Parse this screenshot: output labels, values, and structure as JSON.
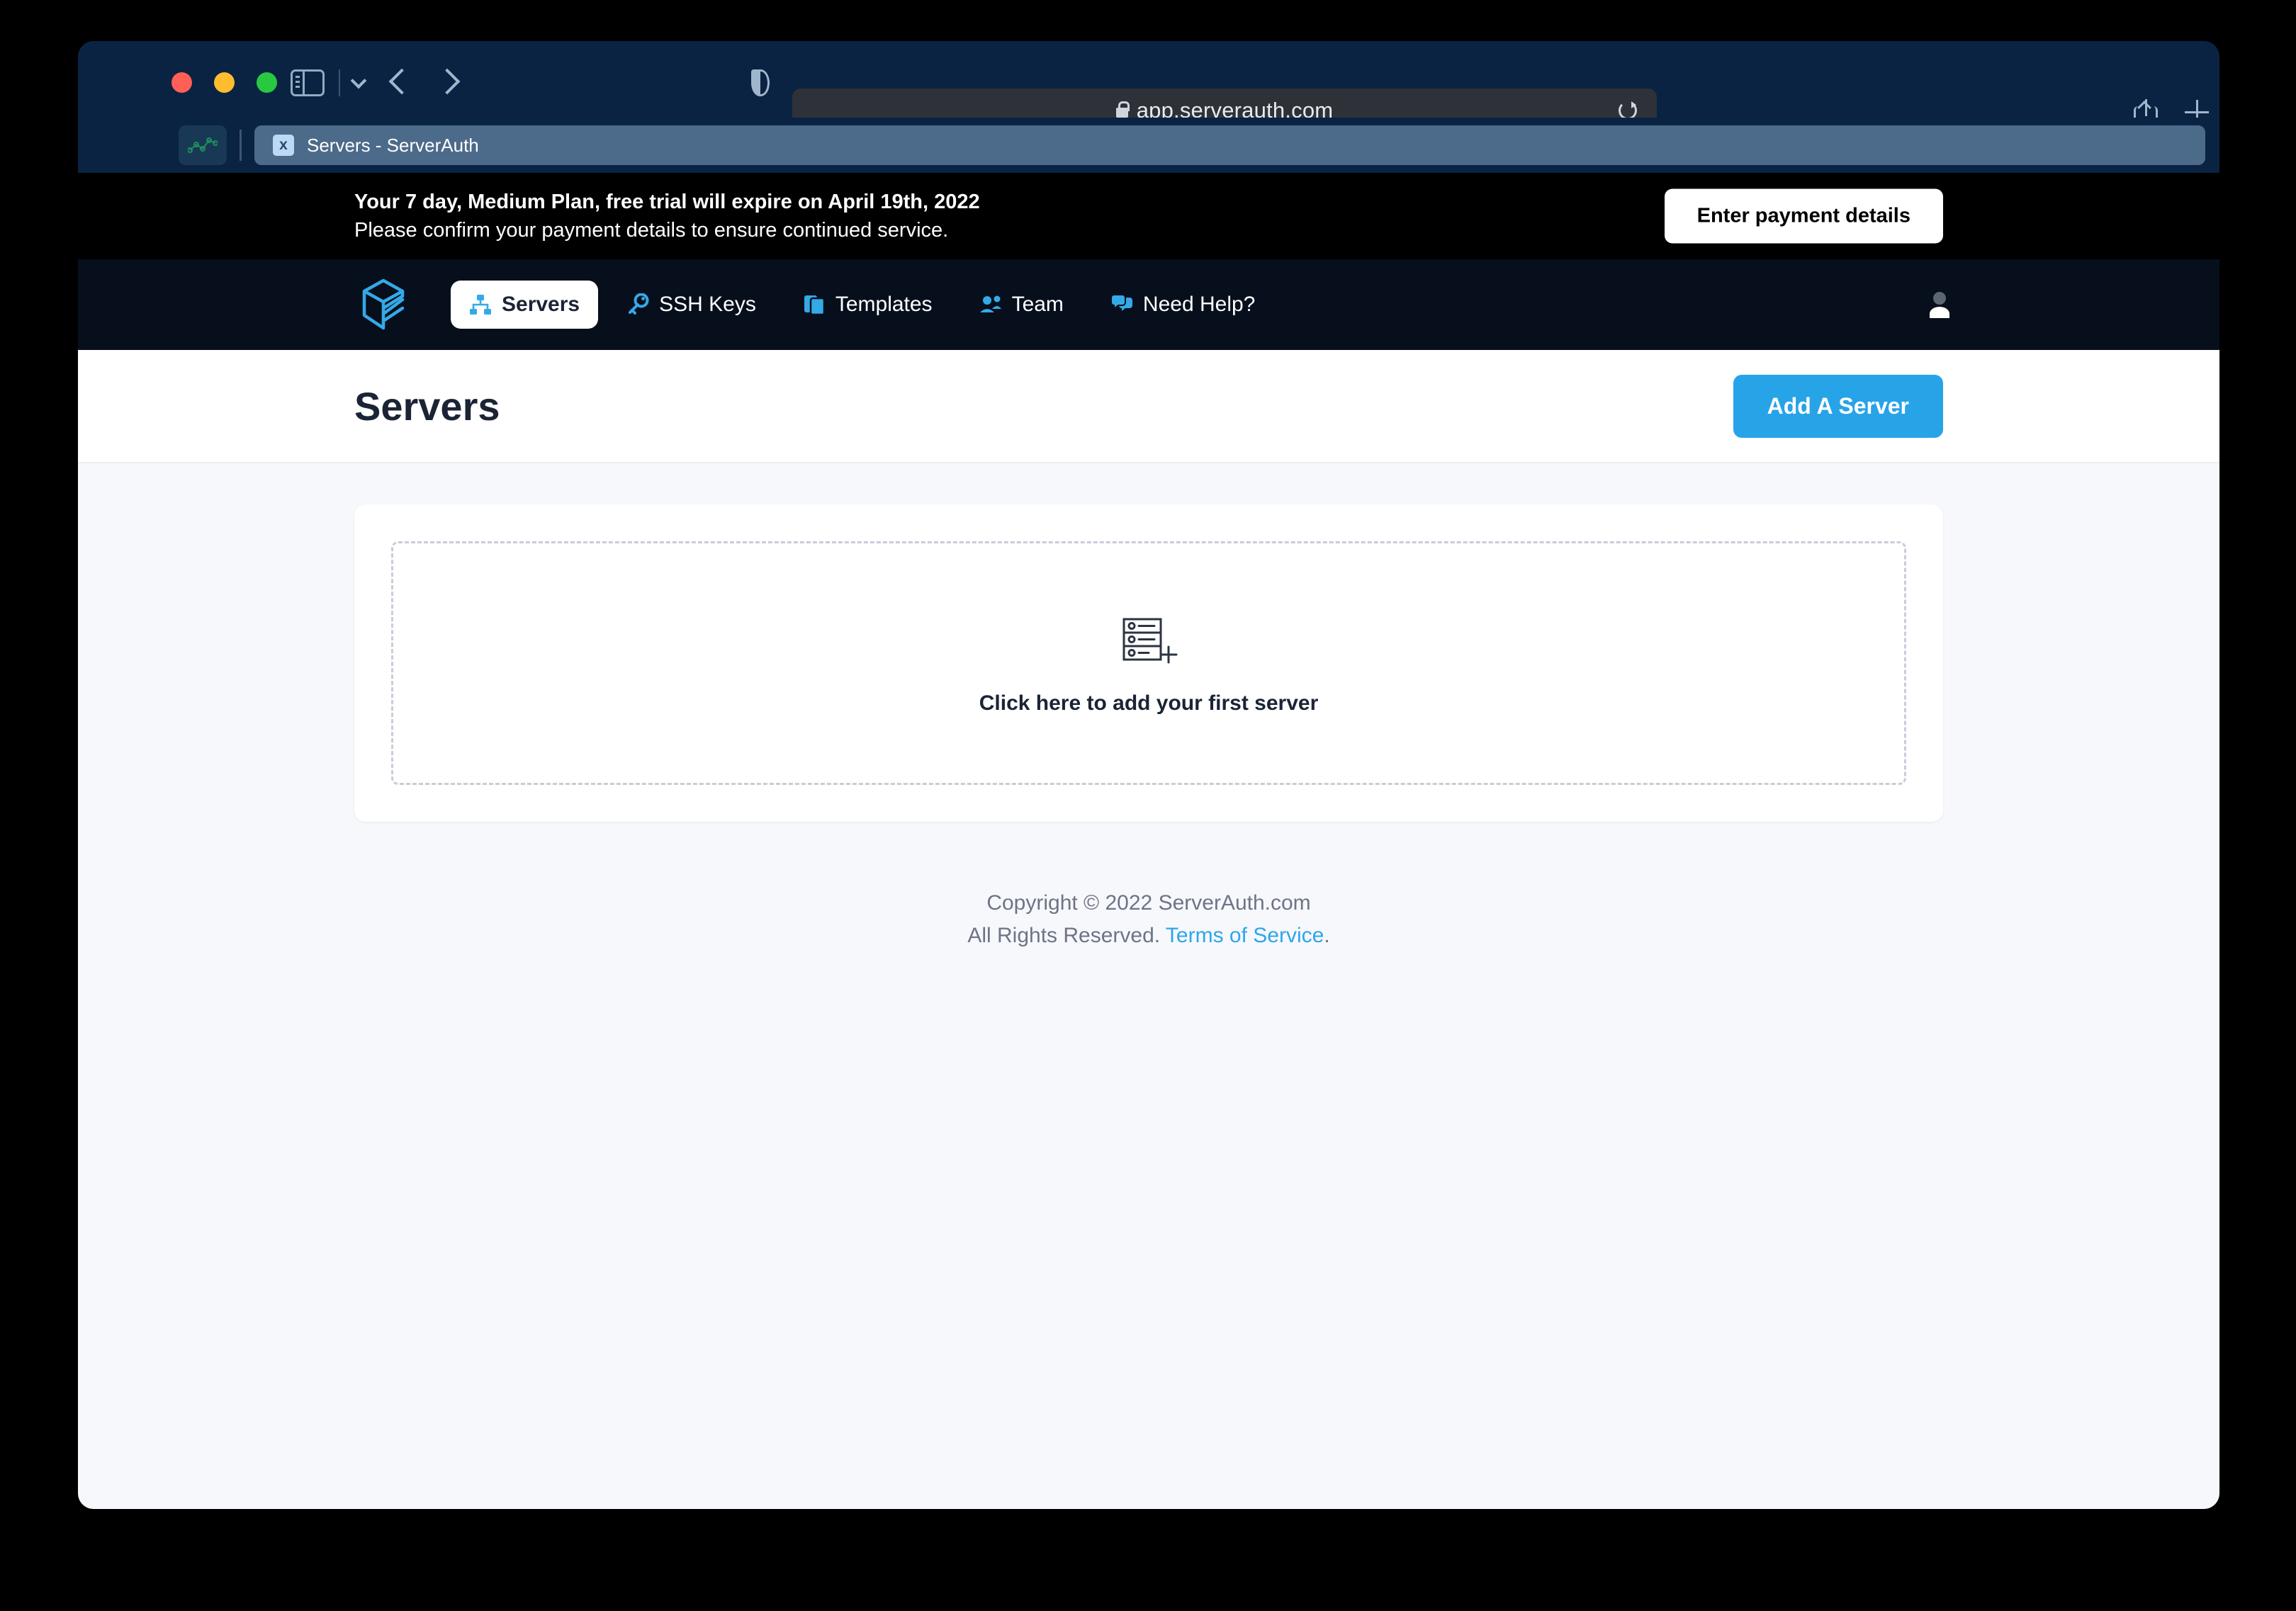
{
  "browser": {
    "url": "app.serverauth.com",
    "lock_icon": "lock-icon",
    "reload_icon": "reload-icon",
    "back_icon": "chevron-left-icon",
    "forward_icon": "chevron-right-icon",
    "sidebar_icon": "sidebar-toggle-icon",
    "tab_menu_icon": "chevron-down-icon",
    "shield_icon": "privacy-shield-icon",
    "share_icon": "share-icon",
    "new_tab_icon": "plus-icon",
    "tab_overview_icon": "tab-overview-icon",
    "pinned_tab_icon": "analytics-chart-icon",
    "tab": {
      "favicon_glyph": "x",
      "title": "Servers - ServerAuth"
    }
  },
  "banner": {
    "line1": "Your 7 day, Medium Plan, free trial will expire on April 19th, 2022",
    "line2": "Please confirm your payment details to ensure continued service.",
    "button_label": "Enter payment details"
  },
  "nav": {
    "logo_icon": "serverauth-stack-logo",
    "avatar_icon": "user-avatar-icon",
    "items": [
      {
        "label": "Servers",
        "icon": "sitemap-icon",
        "active": true
      },
      {
        "label": "SSH Keys",
        "icon": "key-icon",
        "active": false
      },
      {
        "label": "Templates",
        "icon": "copy-icon",
        "active": false
      },
      {
        "label": "Team",
        "icon": "users-icon",
        "active": false
      },
      {
        "label": "Need Help?",
        "icon": "chat-icon",
        "active": false
      }
    ]
  },
  "page": {
    "title": "Servers",
    "add_server_label": "Add A Server"
  },
  "empty_state": {
    "icon": "server-rack-add-icon",
    "label": "Click here to add your first server"
  },
  "footer": {
    "copyright": "Copyright © 2022 ServerAuth.com",
    "rights": "All Rights Reserved.",
    "terms_label": "Terms of Service",
    "period": "."
  },
  "colors": {
    "accent": "#27a3e8",
    "nav_bg": "#070f1c",
    "banner_bg": "#000000",
    "page_bg": "#f7f8fc",
    "browser_chrome": "#0a2342",
    "link": "#2ca6ec"
  }
}
